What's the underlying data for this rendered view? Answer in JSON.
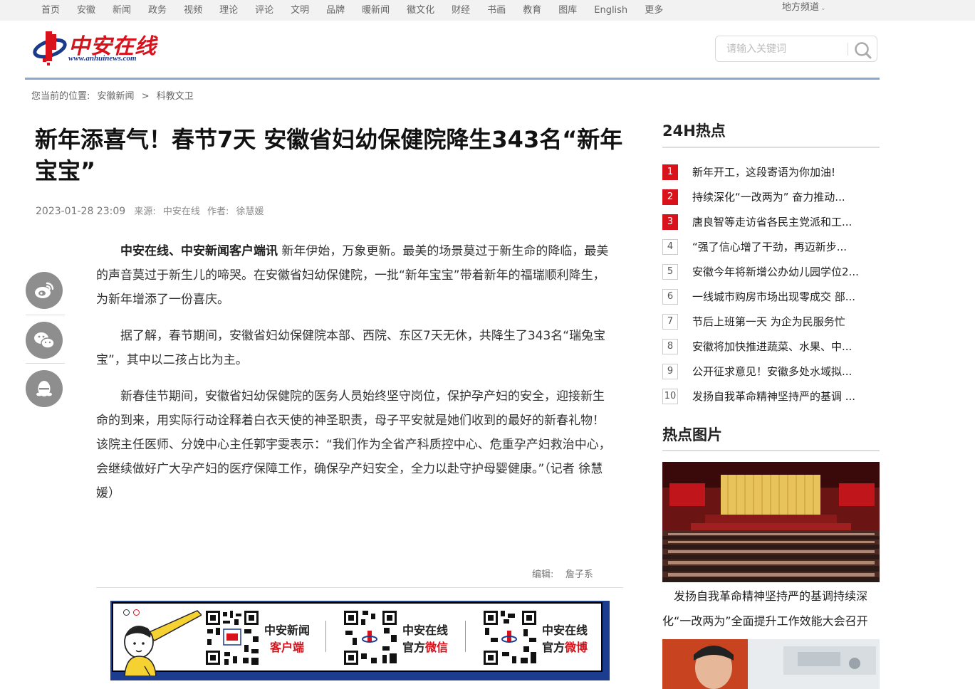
{
  "topnav": {
    "items": [
      "首页",
      "安徽",
      "新闻",
      "政务",
      "视频",
      "理论",
      "评论",
      "文明",
      "品牌",
      "暖新闻",
      "徽文化",
      "财经",
      "书画",
      "教育",
      "图库",
      "English",
      "更多"
    ],
    "region": "地方频道"
  },
  "logo": {
    "name": "中安在线",
    "url": "www.anhuinews.com"
  },
  "search": {
    "placeholder": "请输入关键词"
  },
  "breadcrumb": {
    "label": "您当前的位置:",
    "level1": "安徽新闻",
    "separator": ">",
    "level2": "科教文卫"
  },
  "article": {
    "title": "新年添喜气！春节7天 安徽省妇幼保健院降生343名“新年宝宝”",
    "date": "2023-01-28 23:09",
    "source_label": "来源:",
    "source": "中安在线",
    "author_label": "作者:",
    "author": "徐慧媛",
    "lead": "中安在线、中安新闻客户端讯",
    "p1": " 新年伊始，万象更新。最美的场景莫过于新生命的降临，最美的声音莫过于新生儿的啼哭。在安徽省妇幼保健院，一批“新年宝宝”带着新年的福瑞顺利降生，为新年增添了一份喜庆。",
    "p2": "据了解，春节期间，安徽省妇幼保健院本部、西院、东区7天无休，共降生了343名“瑞兔宝宝”，其中以二孩占比为主。",
    "p3": "新春佳节期间，安徽省妇幼保健院的医务人员始终坚守岗位，保护孕产妇的安全，迎接新生命的到来，用实际行动诠释着白衣天使的神圣职责，母子平安就是她们收到的最好的新春礼物！该院主任医师、分娩中心主任郭宇雯表示：“我们作为全省产科质控中心、危重孕产妇救治中心，会继续做好广大孕产妇的医疗保障工作，确保孕产妇安全，全力以赴守护母婴健康。”（记者 徐慧媛）",
    "editor_label": "编辑:",
    "editor": "詹子系"
  },
  "banner": {
    "items": [
      {
        "line1": "中安新闻",
        "line2": "客户端"
      },
      {
        "line1": "中安在线",
        "line2a": "官方",
        "line2b": "微信"
      },
      {
        "line1": "中安在线",
        "line2a": "官方",
        "line2b": "微博"
      }
    ]
  },
  "sidebar": {
    "hot_title": "24H热点",
    "hot_items": [
      {
        "num": "1",
        "text": "新年开工，这段寄语为你加油!"
      },
      {
        "num": "2",
        "text": "持续深化“一改两为” 奋力推动..."
      },
      {
        "num": "3",
        "text": "唐良智等走访省各民主党派和工..."
      },
      {
        "num": "4",
        "text": "“强了信心增了干劲，再迈新步..."
      },
      {
        "num": "5",
        "text": "安徽今年将新增公办幼儿园学位2..."
      },
      {
        "num": "6",
        "text": "一线城市购房市场出现零成交 部..."
      },
      {
        "num": "7",
        "text": "节后上班第一天 为企为民服务忙"
      },
      {
        "num": "8",
        "text": "安徽将加快推进蔬菜、水果、中..."
      },
      {
        "num": "9",
        "text": "公开征求意见！安徽多处水域拟..."
      },
      {
        "num": "10",
        "text": "发扬自我革命精神坚持严的基调 ..."
      }
    ],
    "pic_title": "热点图片",
    "pic_caption": "发扬自我革命精神坚持严的基调持续深化“一改两为”全面提升工作效能大会召开"
  },
  "colors": {
    "brand_red": "#d8111a",
    "nav_bg": "#f2f2f2",
    "accent_blue": "#8aa8cf",
    "banner_blue": "#1b3c8f"
  }
}
